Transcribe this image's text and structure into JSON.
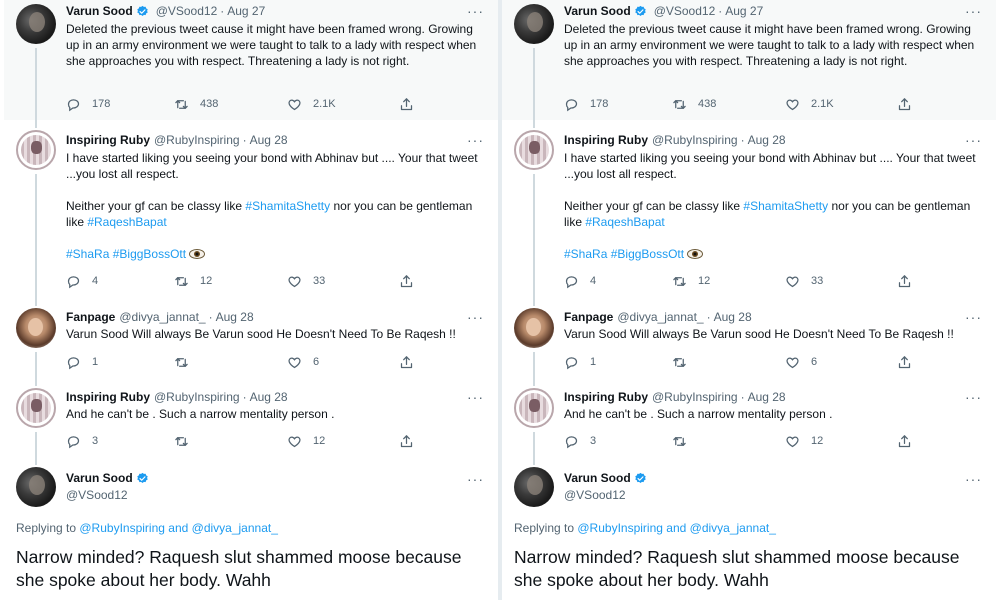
{
  "thread": {
    "tweets": [
      {
        "id": "varun-1",
        "author": "Varun Sood",
        "handle": "@VSood12",
        "date": "Aug 27",
        "verified": true,
        "avatar": "varun-avatar",
        "paragraphs": [
          [
            {
              "t": "Deleted the previous tweet cause it might have been framed wrong. Growing up in an army environment we were taught to talk to a lady with respect when she approaches you with respect. Threatening a lady is not right."
            }
          ]
        ],
        "stats": {
          "replies": "178",
          "retweets": "438",
          "likes": "2.1K"
        }
      },
      {
        "id": "ruby-1",
        "author": "Inspiring Ruby",
        "handle": "@RubyInspiring",
        "date": "Aug 28",
        "verified": false,
        "avatar": "ruby-avatar",
        "paragraphs": [
          [
            {
              "t": "I have started liking you seeing your bond with Abhinav but .... Your that tweet ...you lost all respect."
            }
          ],
          [
            {
              "t": "Neither  your gf can be classy like "
            },
            {
              "t": "#ShamitaShetty",
              "link": true
            },
            {
              "t": " nor  you can be gentleman like "
            },
            {
              "t": "#RaqeshBapat",
              "link": true
            }
          ],
          [
            {
              "t": "#ShaRa",
              "link": true
            },
            {
              "t": " "
            },
            {
              "t": "#BiggBossOtt",
              "link": true
            },
            {
              "t": " "
            },
            {
              "emoji": "eye-emoji"
            }
          ]
        ],
        "stats": {
          "replies": "4",
          "retweets": "12",
          "likes": "33"
        }
      },
      {
        "id": "fan-1",
        "author": "Fanpage",
        "handle": "@divya_jannat_",
        "date": "Aug 28",
        "verified": false,
        "avatar": "fanpage-avatar",
        "paragraphs": [
          [
            {
              "t": "Varun Sood Will always Be Varun sood He Doesn't Need To Be Raqesh !!"
            }
          ]
        ],
        "stats": {
          "replies": "1",
          "retweets": "",
          "likes": "6"
        }
      },
      {
        "id": "ruby-2",
        "author": "Inspiring Ruby",
        "handle": "@RubyInspiring",
        "date": "Aug 28",
        "verified": false,
        "avatar": "ruby-avatar",
        "paragraphs": [
          [
            {
              "t": "And he can't be . Such a narrow mentality person ."
            }
          ]
        ],
        "stats": {
          "replies": "3",
          "retweets": "",
          "likes": "12"
        }
      }
    ],
    "main": {
      "author": "Varun Sood",
      "handle": "@VSood12",
      "verified": true,
      "replying_prefix": "Replying to ",
      "replying_to_1": "@RubyInspiring",
      "replying_and": " and ",
      "replying_to_2": "@divya_jannat_",
      "text": "Narrow minded? Raquesh slut shammed moose because she spoke about her body. Wahh"
    },
    "more_icon": "···",
    "colors": {
      "link": "#1d9bf0",
      "secondary": "#536471",
      "verified": "#1d9bf0",
      "shaded_bg": "#f7f9f9"
    }
  }
}
